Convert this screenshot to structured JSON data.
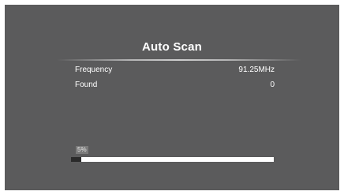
{
  "screen": {
    "title": "Auto Scan"
  },
  "info": {
    "rows": [
      {
        "label": "Frequency",
        "value": "91.25MHz"
      },
      {
        "label": "Found",
        "value": "0"
      }
    ]
  },
  "progress": {
    "percent_label": "5%",
    "fraction": 0.05
  },
  "colors": {
    "background": "#5b5b5c",
    "text": "#ffffff",
    "track": "#ffffff",
    "fill": "#2a2a2a"
  }
}
